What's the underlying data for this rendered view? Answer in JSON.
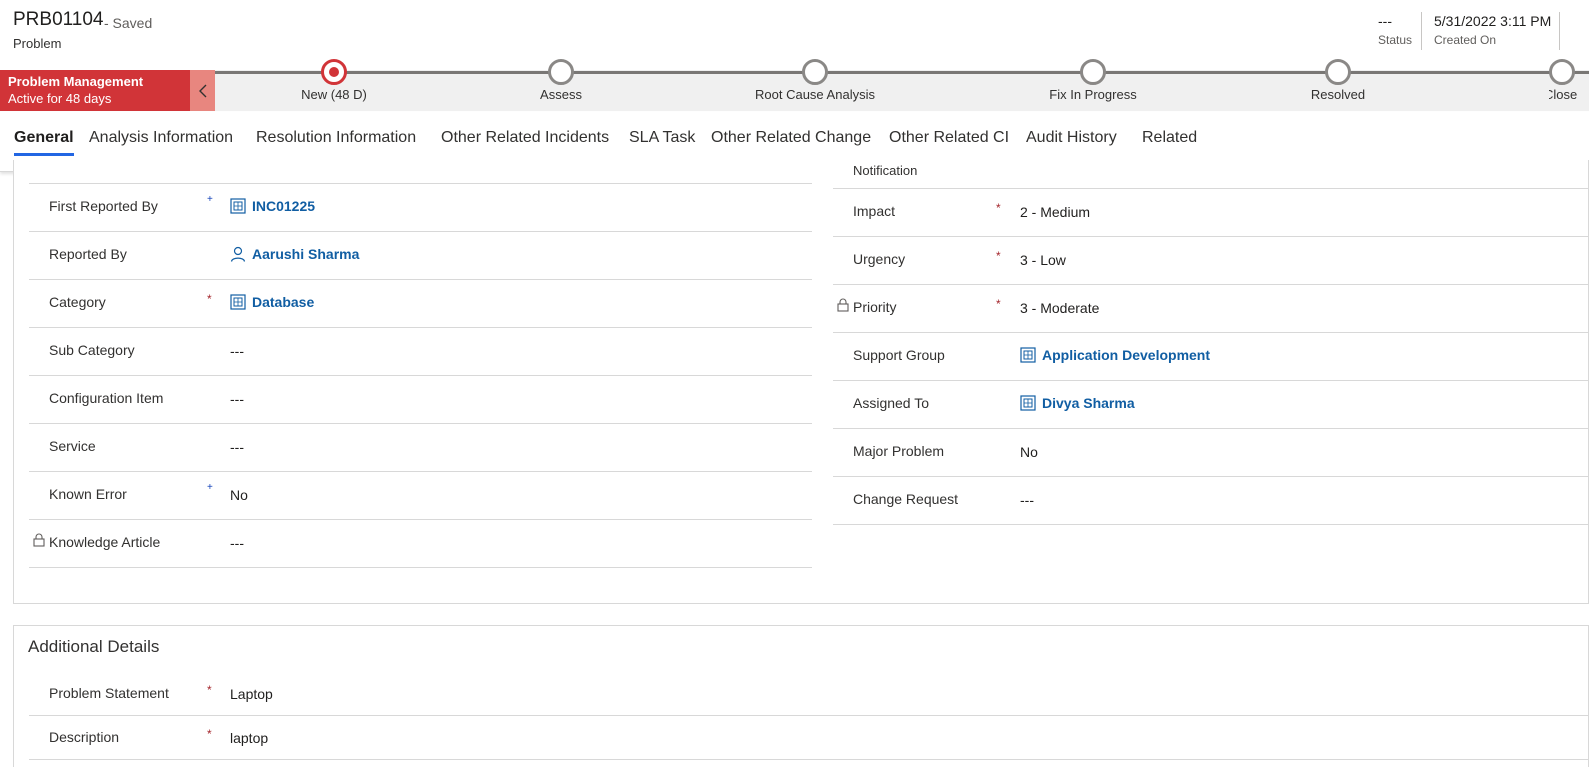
{
  "header": {
    "record_number": "PRB01104",
    "save_state": "- Saved",
    "entity": "Problem",
    "status_value": "---",
    "status_label": "Status",
    "created_value": "5/31/2022 3:11 PM",
    "created_label": "Created On"
  },
  "bpf": {
    "process_name": "Problem Management",
    "active_duration": "Active for 48 days",
    "stages": [
      {
        "label": "New  (48 D)",
        "active": true
      },
      {
        "label": "Assess",
        "active": false
      },
      {
        "label": "Root Cause Analysis",
        "active": false
      },
      {
        "label": "Fix In Progress",
        "active": false
      },
      {
        "label": "Resolved",
        "active": false
      },
      {
        "label": "Close",
        "active": false
      }
    ],
    "accent_color": "#d13438"
  },
  "tabs": [
    "General",
    "Analysis Information",
    "Resolution Information",
    "Other Related Incidents",
    "SLA Task",
    "Other Related Change",
    "Other Related CI",
    "Audit History",
    "Related"
  ],
  "general": {
    "left": [
      {
        "label": "First Reported By",
        "value": "INC01225",
        "kind": "lookup",
        "marker": "recommended"
      },
      {
        "label": "Reported By",
        "value": "Aarushi Sharma",
        "kind": "user"
      },
      {
        "label": "Category",
        "value": "Database",
        "kind": "lookup",
        "marker": "required"
      },
      {
        "label": "Sub Category",
        "value": "---",
        "kind": "text"
      },
      {
        "label": "Configuration Item",
        "value": "---",
        "kind": "text"
      },
      {
        "label": "Service",
        "value": "---",
        "kind": "text"
      },
      {
        "label": "Known Error",
        "value": "No",
        "kind": "text",
        "marker": "recommended"
      },
      {
        "label": "Knowledge Article",
        "value": "---",
        "kind": "text",
        "locked": true
      }
    ],
    "right_partial_label": "Notification",
    "right": [
      {
        "label": "Impact",
        "value": "2 - Medium",
        "kind": "text",
        "marker": "required"
      },
      {
        "label": "Urgency",
        "value": "3 - Low",
        "kind": "text",
        "marker": "required"
      },
      {
        "label": "Priority",
        "value": "3 - Moderate",
        "kind": "text",
        "marker": "required",
        "locked": true
      },
      {
        "label": "Support Group",
        "value": "Application Development",
        "kind": "lookup"
      },
      {
        "label": "Assigned To",
        "value": "Divya Sharma",
        "kind": "lookup"
      },
      {
        "label": "Major Problem",
        "value": "No",
        "kind": "text"
      },
      {
        "label": "Change Request",
        "value": "---",
        "kind": "text"
      }
    ]
  },
  "additional": {
    "title": "Additional Details",
    "rows": [
      {
        "label": "Problem Statement",
        "value": "Laptop"
      },
      {
        "label": "Description",
        "value": "laptop"
      }
    ]
  },
  "markers": {
    "required": "*",
    "recommended": "+"
  },
  "icons": {
    "lookup": "entity-icon",
    "user": "person-icon",
    "lock": "lock-icon",
    "collapse": "chevron-left-icon"
  }
}
